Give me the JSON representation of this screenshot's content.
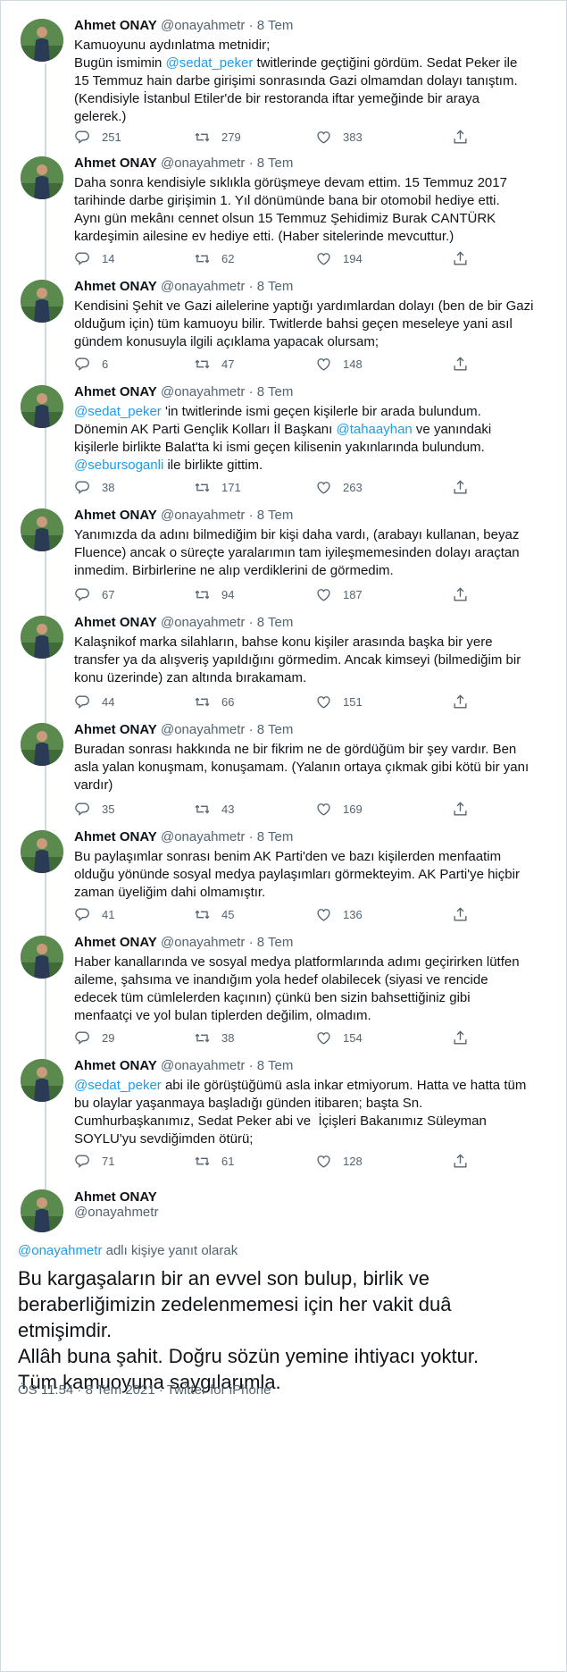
{
  "author": {
    "name": "Ahmet ONAY",
    "handle": "@onayahmetr",
    "date": "8 Tem"
  },
  "tweets": [
    {
      "segments": [
        {
          "t": "Kamuoyunu aydınlatma metnidir;\nBugün ismimin "
        },
        {
          "t": "@sedat_peker",
          "m": true
        },
        {
          "t": " twitlerinde geçtiğini gördüm. Sedat Peker ile\n15 Temmuz hain darbe girişimi sonrasında Gazi olmamdan dolayı tanıştım.\n(Kendisiyle İstanbul Etiler'de bir restoranda iftar yemeğinde bir araya\ngelerek.)"
        }
      ],
      "replies": "251",
      "retweets": "279",
      "likes": "383"
    },
    {
      "segments": [
        {
          "t": "Daha sonra kendisiyle sıklıkla görüşmeye devam ettim. 15 Temmuz 2017\ntarihinde darbe girişimin 1. Yıl dönümünde bana bir otomobil hediye etti.\nAynı gün mekânı cennet olsun 15 Temmuz Şehidimiz Burak CANTÜRK\nkardeşimin ailesine ev hediye etti. (Haber sitelerinde mevcuttur.)"
        }
      ],
      "replies": "14",
      "retweets": "62",
      "likes": "194"
    },
    {
      "segments": [
        {
          "t": "Kendisini Şehit ve Gazi ailelerine yaptığı yardımlardan dolayı (ben de bir Gazi\nolduğum için) tüm kamuoyu bilir. Twitlerde bahsi geçen meseleye yani asıl\ngündem konusuyla ilgili açıklama yapacak olursam;"
        }
      ],
      "replies": "6",
      "retweets": "47",
      "likes": "148"
    },
    {
      "segments": [
        {
          "t": "@sedat_peker",
          "m": true
        },
        {
          "t": " 'in twitlerinde ismi geçen kişilerle bir arada bulundum.\nDönemin AK Parti Gençlik Kolları İl Başkanı "
        },
        {
          "t": "@tahaayhan",
          "m": true
        },
        {
          "t": " ve yanındaki\nkişilerle birlikte Balat'ta ki ismi geçen kilisenin yakınlarında bulundum.\n"
        },
        {
          "t": "@sebursoganli",
          "m": true
        },
        {
          "t": " ile birlikte gittim."
        }
      ],
      "replies": "38",
      "retweets": "171",
      "likes": "263"
    },
    {
      "segments": [
        {
          "t": "Yanımızda da adını bilmediğim bir kişi daha vardı, (arabayı kullanan, beyaz\nFluence) ancak o süreçte yaralarımın tam iyileşmemesinden dolayı araçtan\ninmedim. Birbirlerine ne alıp verdiklerini de görmedim."
        }
      ],
      "replies": "67",
      "retweets": "94",
      "likes": "187"
    },
    {
      "segments": [
        {
          "t": "Kalaşnikof marka silahların, bahse konu kişiler arasında başka bir yere\ntransfer ya da alışveriş yapıldığını görmedim. Ancak kimseyi (bilmediğim bir\nkonu üzerinde) zan altında bırakamam."
        }
      ],
      "replies": "44",
      "retweets": "66",
      "likes": "151"
    },
    {
      "segments": [
        {
          "t": "Buradan sonrası hakkında ne bir fikrim ne de gördüğüm bir şey vardır. Ben\nasla yalan konuşmam, konuşamam. (Yalanın ortaya çıkmak gibi kötü bir yanı\nvardır)"
        }
      ],
      "replies": "35",
      "retweets": "43",
      "likes": "169"
    },
    {
      "segments": [
        {
          "t": "Bu paylaşımlar sonrası benim AK Parti'den ve bazı kişilerden menfaatim\nolduğu yönünde sosyal medya paylaşımları görmekteyim. AK Parti'ye hiçbir\nzaman üyeliğim dahi olmamıştır."
        }
      ],
      "replies": "41",
      "retweets": "45",
      "likes": "136"
    },
    {
      "segments": [
        {
          "t": "Haber kanallarında ve sosyal medya platformlarında adımı geçirirken lütfen\naileme, şahsıma ve inandığım yola hedef olabilecek (siyasi ve rencide\nedecek tüm cümlelerden kaçının) çünkü ben sizin bahsettiğiniz gibi\nmenfaatçi ve yol bulan tiplerden değilim, olmadım."
        }
      ],
      "replies": "29",
      "retweets": "38",
      "likes": "154"
    },
    {
      "segments": [
        {
          "t": "@sedat_peker",
          "m": true
        },
        {
          "t": " abi ile görüştüğümü asla inkar etmiyorum. Hatta ve hatta tüm\nbu olaylar yaşanmaya başladığı günden itibaren; başta Sn.\nCumhurbaşkanımız, Sedat Peker abi ve  İçişleri Bakanımız Süleyman\nSOYLU'yu sevdiğimden ötürü;"
        }
      ],
      "replies": "71",
      "retweets": "61",
      "likes": "128"
    }
  ],
  "main": {
    "name": "Ahmet ONAY",
    "handle": "@onayahmetr",
    "reply_to_handle": "@onayahmetr",
    "reply_to_suffix": " adlı kişiye yanıt olarak",
    "text": "Bu kargaşaların bir an evvel son bulup, birlik ve\nberaberliğimizin zedelenmemesi için her vakit duâ\netmişimdir.\nAllâh buna şahit. Doğru sözün yemine ihtiyacı yoktur.\nTüm kamuoyuna saygılarımla.",
    "footer": "ÖS 11:54 · 8 Tem 2021 · Twitter for iPhone"
  },
  "colors": {
    "accent": "#1d9bf0",
    "muted": "#536471",
    "text": "#0f1419",
    "line": "#cfd9de"
  },
  "icons": [
    "reply-icon",
    "retweet-icon",
    "like-icon",
    "share-icon"
  ]
}
